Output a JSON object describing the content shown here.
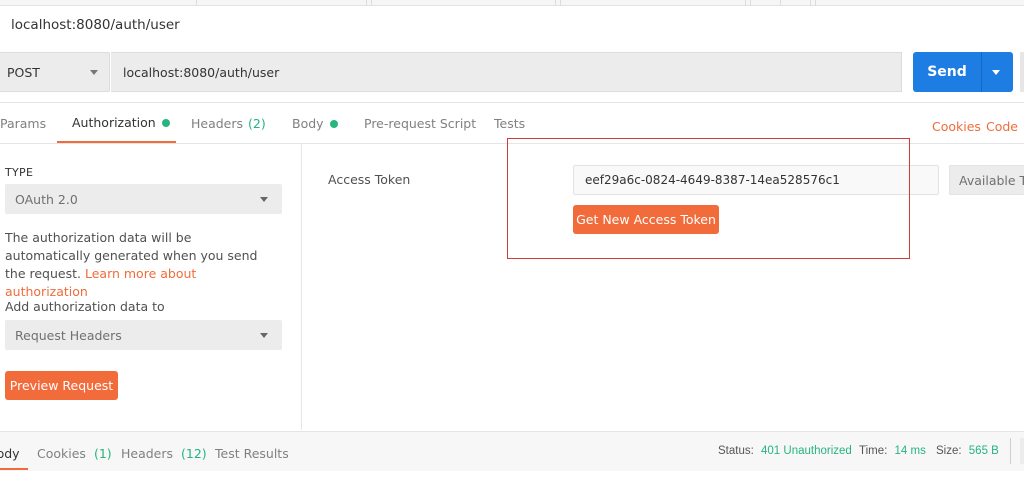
{
  "request": {
    "title": "localhost:8080/auth/user",
    "method": "POST",
    "url": "localhost:8080/auth/user",
    "send_label": "Send"
  },
  "tabs": {
    "params": "Params",
    "authorization": "Authorization",
    "headers": "Headers",
    "headers_count": "(2)",
    "body": "Body",
    "prerequest": "Pre-request Script",
    "tests": "Tests",
    "cookies": "Cookies",
    "code": "Code"
  },
  "auth": {
    "type_label": "TYPE",
    "type_value": "OAuth 2.0",
    "description": "The authorization data will be automatically generated when you send the request.",
    "learn_more": "Learn more about authorization",
    "add_to_label": "Add authorization data to",
    "add_to_value": "Request Headers",
    "preview_button": "Preview Request",
    "access_token_label": "Access Token",
    "access_token_value": "eef29a6c-0824-4649-8387-14ea528576c1",
    "get_token_button": "Get New Access Token",
    "available_tokens": "Available Tokens"
  },
  "response": {
    "tabs": {
      "body": "Body",
      "cookies": "Cookies",
      "cookies_count": "(1)",
      "headers": "Headers",
      "headers_count": "(12)",
      "test_results": "Test Results"
    },
    "status_label": "Status:",
    "status_value": "401 Unauthorized",
    "time_label": "Time:",
    "time_value": "14 ms",
    "size_label": "Size:",
    "size_value": "565 B"
  },
  "colors": {
    "accent": "#f26b3a",
    "send_blue": "#1d7de3",
    "success_green": "#26b47f",
    "highlight_red": "#d33a3a"
  }
}
